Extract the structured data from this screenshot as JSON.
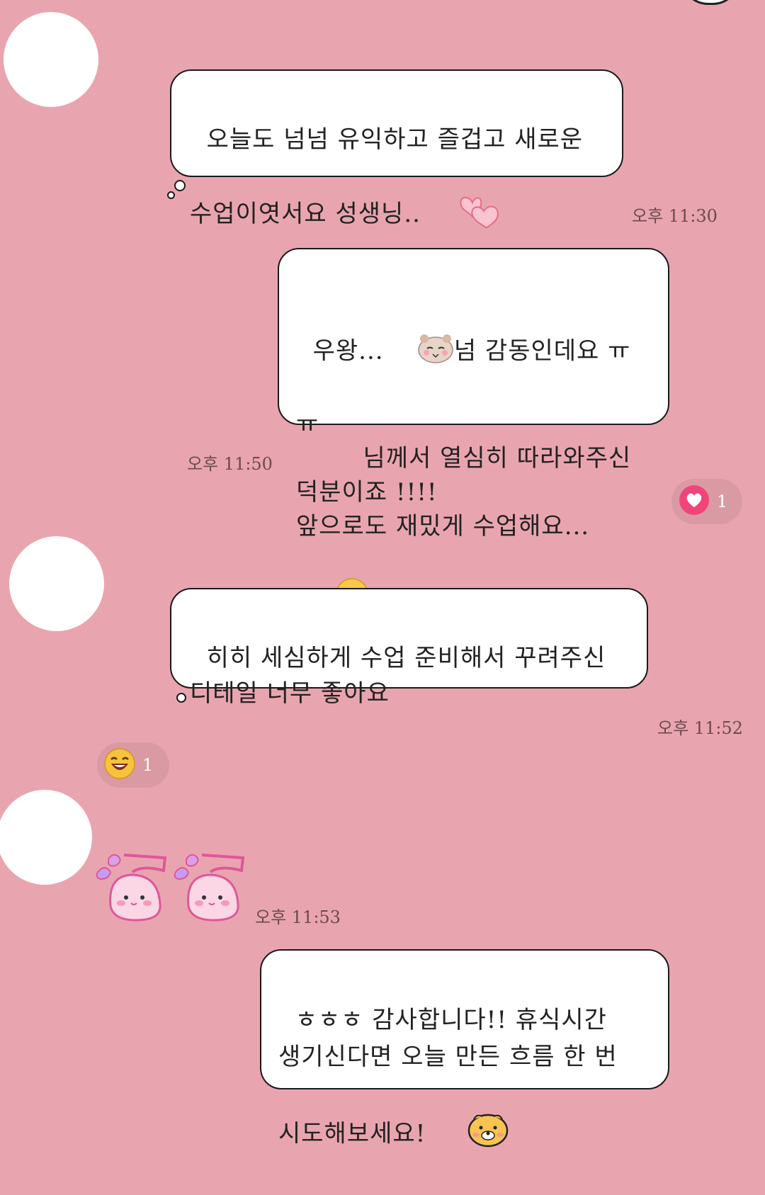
{
  "messages": [
    {
      "text": "오늘도 넘넘 유익하고 즐겁고 새로운\n수업이엿서요 성생닝..",
      "time": "오후 11:30"
    },
    {
      "text_line1": "우왕...",
      "text_line1b": "넘 감동인데요 ㅠㅠ",
      "text_rest": "      님께서 열심히 따라와주신\n덕분이죠 !!!!\n앞으로도 재밌게 수업해요...",
      "time": "오후 11:50"
    },
    {
      "text": "히히 세심하게 수업 준비해서 꾸려주신\n디테일 너무 좋아요",
      "time": "오후 11:52"
    },
    {
      "time": "오후 11:53"
    },
    {
      "text": "ㅎㅎㅎ 감사합니다!! 휴식시간\n생기신다면 오늘 만든 흐름 한 번\n시도해보세요!"
    }
  ],
  "reactions": [
    {
      "icon": "heart-icon",
      "count": "1",
      "color": "#f0457a"
    },
    {
      "icon": "laughing-emoji-icon",
      "count": "1",
      "color": "#f7c23c"
    }
  ],
  "colors": {
    "background": "#e9a5af",
    "bubble": "#ffffff",
    "outline": "#1a1a1a"
  }
}
